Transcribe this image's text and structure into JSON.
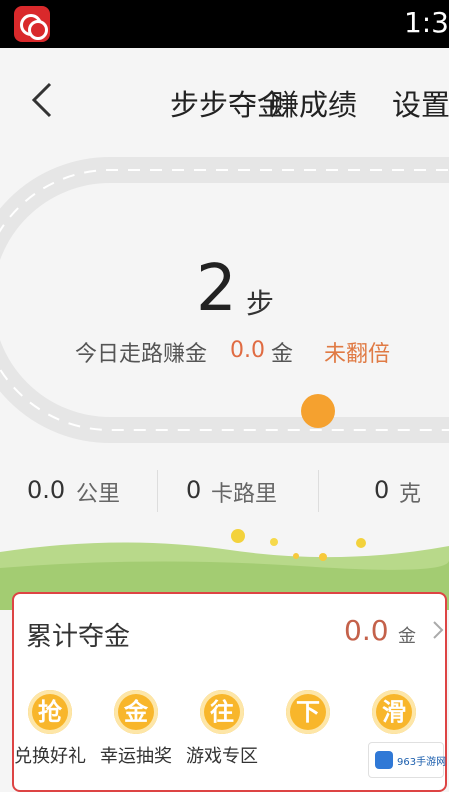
{
  "status_bar": {
    "time": "1:3"
  },
  "header": {
    "title": "步步夺金",
    "overlap_title": "赚成绩",
    "settings_label": "设置"
  },
  "today": {
    "steps": "2",
    "steps_unit": "步",
    "earn_label": "今日走路赚金",
    "earn_value": "0.0",
    "earn_unit": "金",
    "double_status": "未翻倍",
    "progress_fraction": 0.74
  },
  "stats": [
    {
      "value": "0.0",
      "unit": "公里"
    },
    {
      "value": "0",
      "unit": "卡路里"
    },
    {
      "value": "0",
      "unit": "克"
    }
  ],
  "accumulated": {
    "title": "累计夺金",
    "value": "0.0",
    "unit": "金"
  },
  "features": [
    {
      "icon": "抢",
      "label": "兑换好礼"
    },
    {
      "icon": "金",
      "label": "幸运抽奖"
    },
    {
      "icon": "往",
      "label": "游戏专区"
    },
    {
      "icon": "下",
      "label": ""
    },
    {
      "icon": "滑",
      "label": ""
    }
  ],
  "watermark": {
    "text": "963手游网"
  },
  "colors": {
    "accent_orange": "#f5a12f",
    "value_red": "#e06b42",
    "card_border": "#dd4444",
    "coin": "#f8b62b"
  }
}
